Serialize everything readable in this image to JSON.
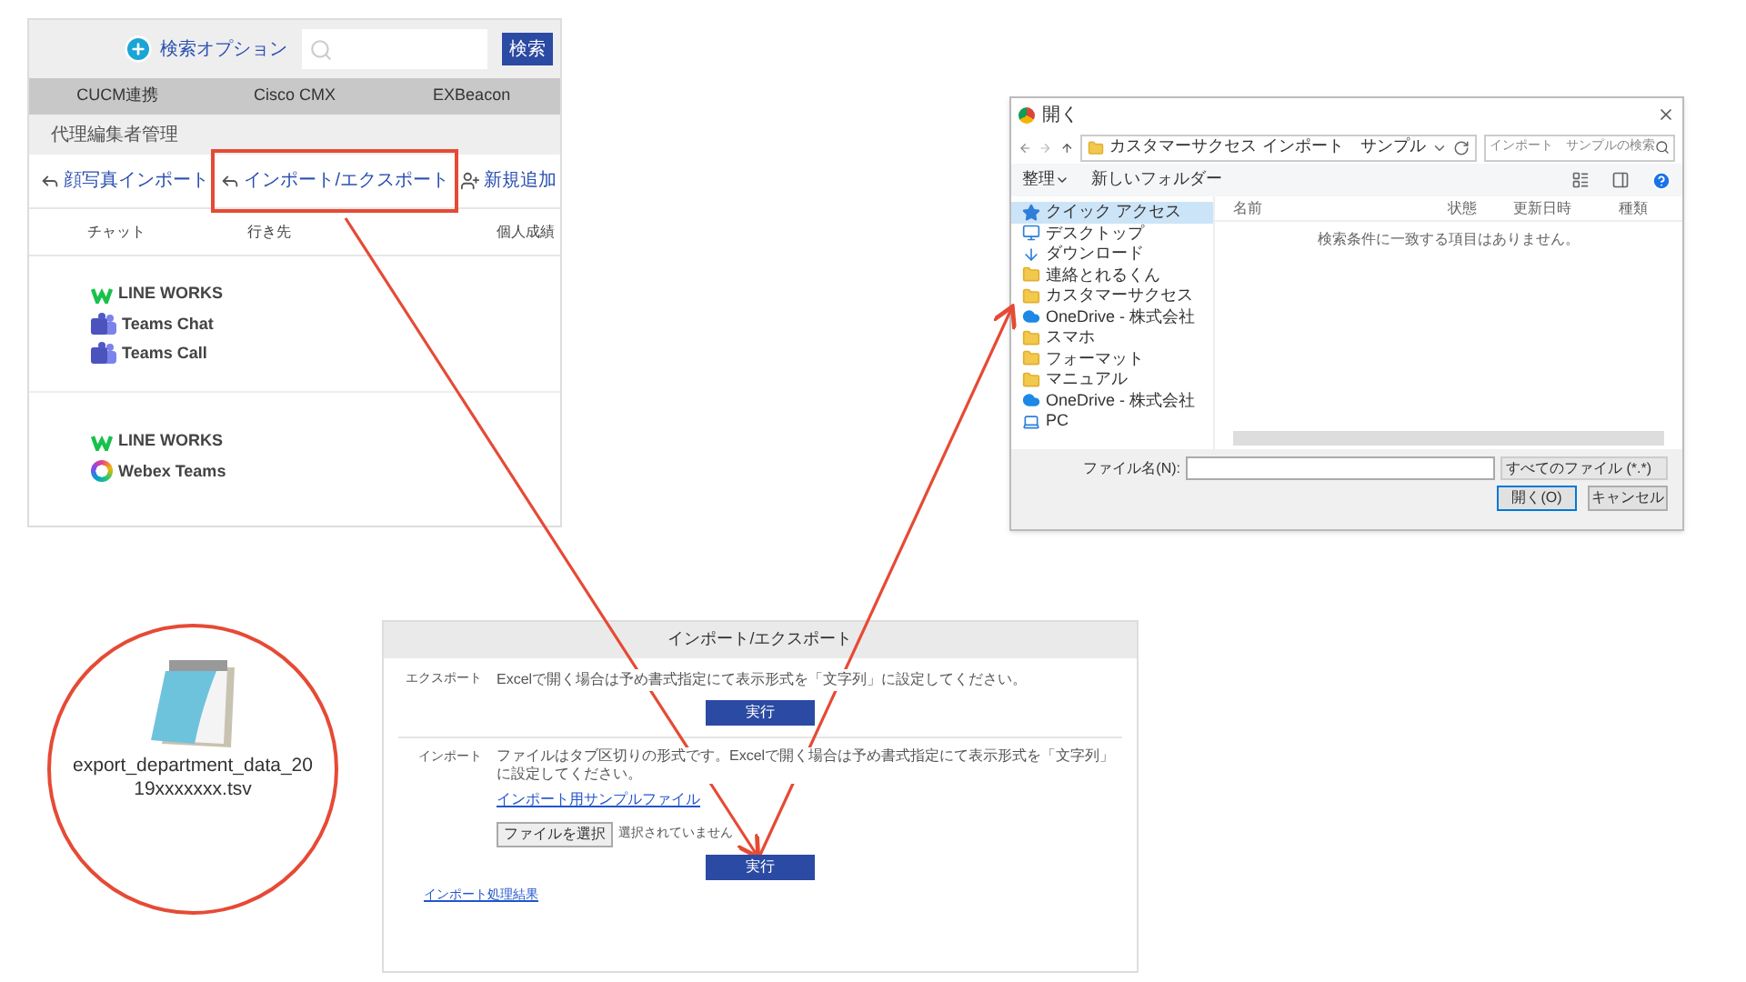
{
  "web_app": {
    "search_option": "検索オプション",
    "search_button": "検索",
    "tabs": [
      "CUCM連携",
      "Cisco CMX",
      "EXBeacon"
    ],
    "section": "代理編集者管理",
    "actions": [
      {
        "kind": "import",
        "label": "顔写真インポート",
        "highlighted": false
      },
      {
        "kind": "import",
        "label": "インポート/エクスポート",
        "highlighted": true
      },
      {
        "kind": "add",
        "label": "新規追加",
        "highlighted": false
      }
    ],
    "columns": [
      "チャット",
      "行き先",
      "個人成績"
    ],
    "rows": [
      {
        "services": [
          {
            "kind": "lineworks",
            "name": "LINE WORKS"
          },
          {
            "kind": "teams",
            "name": "Teams Chat"
          },
          {
            "kind": "teams",
            "name": "Teams Call"
          }
        ]
      },
      {
        "services": [
          {
            "kind": "lineworks",
            "name": "LINE WORKS"
          },
          {
            "kind": "webex",
            "name": "Webex Teams"
          }
        ]
      }
    ]
  },
  "open_dialog": {
    "title": "開く",
    "path": [
      "カスタマーサクセス",
      "インポート　サンプル"
    ],
    "search_placeholder": "インポート　サンプルの検索",
    "toolbar": [
      "整理",
      "新しいフォルダー"
    ],
    "nav": [
      {
        "kind": "star",
        "label": "クイック アクセス",
        "selected": true
      },
      {
        "kind": "desktop",
        "label": "デスクトップ",
        "selected": false
      },
      {
        "kind": "download",
        "label": "ダウンロード",
        "selected": false
      },
      {
        "kind": "folder",
        "label": "連絡とれるくん",
        "selected": false
      },
      {
        "kind": "folder",
        "label": "カスタマーサクセス",
        "selected": false
      },
      {
        "kind": "cloud",
        "label": "OneDrive - 株式会社",
        "selected": false
      },
      {
        "kind": "folder",
        "label": "スマホ",
        "selected": false
      },
      {
        "kind": "folder",
        "label": "フォーマット",
        "selected": false
      },
      {
        "kind": "folder",
        "label": "マニュアル",
        "selected": false
      },
      {
        "kind": "cloud",
        "label": "OneDrive - 株式会社",
        "selected": false
      },
      {
        "kind": "pc",
        "label": "PC",
        "selected": false
      }
    ],
    "columns": [
      "名前",
      "状態",
      "更新日時",
      "種類"
    ],
    "empty_message": "検索条件に一致する項目はありません。",
    "filename_label": "ファイル名(N):",
    "filetype": "すべてのファイル (*.*)",
    "buttons": [
      "開く(O)",
      "キャンセル"
    ]
  },
  "file": {
    "name": "export_department_data_2019xxxxxxx.tsv"
  },
  "import_export": {
    "title": "インポート/エクスポート",
    "export": {
      "label": "エクスポート",
      "text": "Excelで開く場合は予め書式指定にて表示形式を「文字列」に設定してください。",
      "button": "実行"
    },
    "import": {
      "label": "インポート",
      "text": "ファイルはタブ区切りの形式です。Excelで開く場合は予め書式指定にて表示形式を「文字列」に設定してください。",
      "sample_link": "インポート用サンプルファイル",
      "file_button": "ファイルを選択",
      "file_status": "選択されていません",
      "button": "実行"
    },
    "result_link": "インポート処理結果"
  }
}
